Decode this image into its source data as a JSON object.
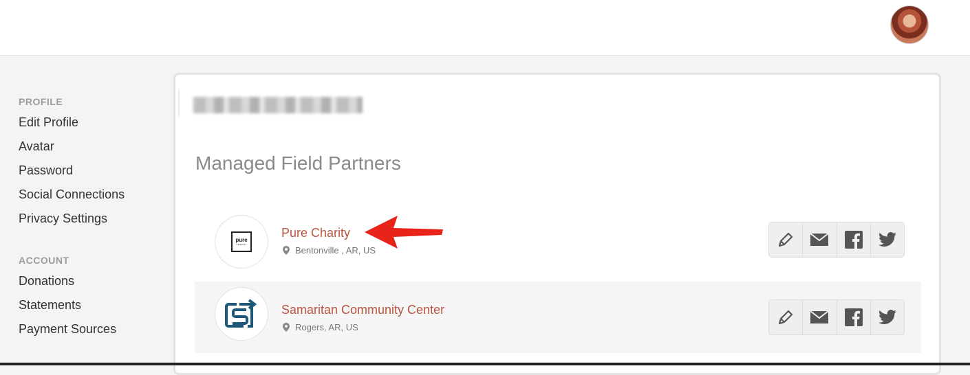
{
  "sidebar": {
    "profile_heading": "PROFILE",
    "profile_items": [
      "Edit Profile",
      "Avatar",
      "Password",
      "Social Connections",
      "Privacy Settings"
    ],
    "account_heading": "ACCOUNT",
    "account_items": [
      "Donations",
      "Statements",
      "Payment Sources"
    ]
  },
  "main": {
    "section_title": "Managed Field Partners",
    "partners": [
      {
        "name": "Pure Charity",
        "location": "Bentonville , AR, US",
        "logo_text": "pure",
        "logo_subtext": "CHARITY"
      },
      {
        "name": "Samaritan Community Center",
        "location": "Rogers, AR, US"
      }
    ]
  },
  "icons": {
    "actions": [
      "pencil-icon",
      "envelope-icon",
      "facebook-icon",
      "twitter-icon"
    ],
    "location": "map-pin-icon"
  },
  "colors": {
    "link": "#b8553f",
    "annotation_arrow": "#e8231a"
  }
}
